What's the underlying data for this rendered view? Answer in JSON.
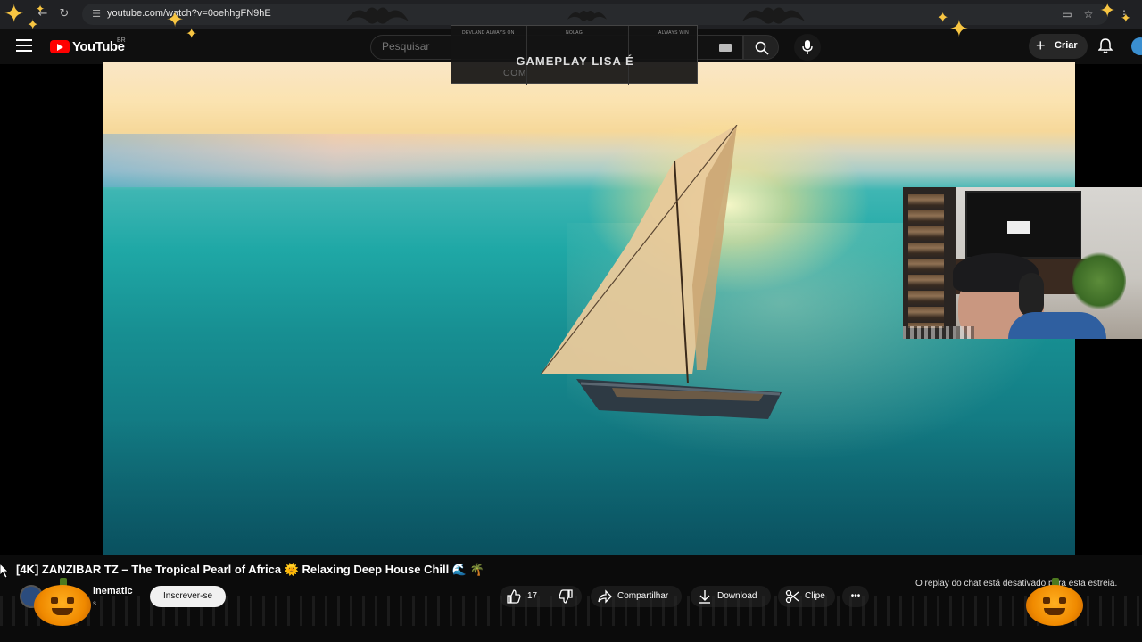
{
  "browser": {
    "url": "youtube.com/watch?v=0oehhgFN9hE"
  },
  "header": {
    "logo_text": "YouTube",
    "region": "BR",
    "search_placeholder": "Pesquisar",
    "create_label": "Criar"
  },
  "overlay": {
    "left_tag": "DEVLAND ALWAYS ON",
    "center_tag": "NOLAG",
    "right_tag": "ALWAYS WIN",
    "title": "GAMEPLAY LISA É",
    "subtitle": "COM"
  },
  "video": {
    "title": "[4K] ZANZIBAR TZ – The Tropical Pearl of Africa 🌞 Relaxing Deep House Chill 🌊 🌴",
    "channel_name": "inematic",
    "subscribers": "s",
    "subscribe_label": "Inscrever-se",
    "like_count": "17",
    "share_label": "Compartilhar",
    "download_label": "Download",
    "clip_label": "Clipe",
    "more_label": "•••"
  },
  "chat": {
    "replay_notice": "O replay do chat está desativado para esta estreia."
  },
  "icons": {
    "back": "arrow-left-icon",
    "reload": "reload-icon",
    "site_info": "tune-icon",
    "search": "search-icon",
    "mic": "mic-icon",
    "bell": "bell-icon",
    "like": "thumbs-up-icon",
    "dislike": "thumbs-down-icon",
    "share": "share-icon",
    "download": "download-icon",
    "clip": "scissors-icon"
  },
  "colors": {
    "brand_red": "#ff0000",
    "halloween_orange": "#f08a00",
    "sparkle_gold": "#f7c542"
  }
}
